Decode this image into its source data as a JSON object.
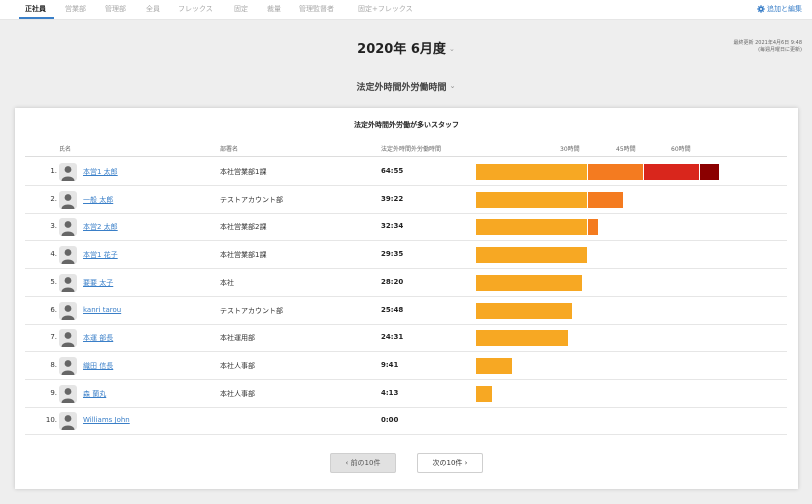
{
  "tabs": [
    {
      "label": "正社員",
      "active": true
    },
    {
      "label": "営業部",
      "active": false
    },
    {
      "label": "管理部",
      "active": false
    },
    {
      "label": "全員",
      "active": false
    },
    {
      "label": "フレックス",
      "active": false
    },
    {
      "label": "固定",
      "active": false
    },
    {
      "label": "裁量",
      "active": false
    },
    {
      "label": "管理監督者",
      "active": false
    },
    {
      "label": "固定+フレックス",
      "active": false
    }
  ],
  "add_edit_label": "追加と編集",
  "period": {
    "label": "2020年 6月度"
  },
  "last_updated": {
    "line1": "最終更新 2021年4月6日 9:48",
    "line2": "(毎週月曜日に更新)"
  },
  "metric_selector": {
    "label": "法定外時間外労働時間"
  },
  "card": {
    "title": "法定外時間外労働が多いスタッフ",
    "columns": {
      "name": "氏名",
      "dept": "部署名",
      "hours": "法定外時間外労働時間"
    },
    "ticks": [
      "30時間",
      "45時間",
      "60時間"
    ]
  },
  "colors": {
    "under_30": "#f7a823",
    "from_30_to_45": "#f47b20",
    "from_45_to_60": "#d9261c",
    "over_60": "#8b0000",
    "link": "#3a7fc8"
  },
  "rows": [
    {
      "rank": "1.",
      "name": "本営1 太郎",
      "dept": "本社営業部1課",
      "hours": "64:55",
      "hours_value": 64.92
    },
    {
      "rank": "2.",
      "name": "一般 太郎",
      "dept": "テストアカウント部",
      "hours": "39:22",
      "hours_value": 39.37
    },
    {
      "rank": "3.",
      "name": "本営2 太郎",
      "dept": "本社営業部2課",
      "hours": "32:34",
      "hours_value": 32.57
    },
    {
      "rank": "4.",
      "name": "本営1 花子",
      "dept": "本社営業部1課",
      "hours": "29:35",
      "hours_value": 29.58
    },
    {
      "rank": "5.",
      "name": "要要 太子",
      "dept": "本社",
      "hours": "28:20",
      "hours_value": 28.33
    },
    {
      "rank": "6.",
      "name": "kanri tarou",
      "dept": "テストアカウント部",
      "hours": "25:48",
      "hours_value": 25.8
    },
    {
      "rank": "7.",
      "name": "本運 部長",
      "dept": "本社運用部",
      "hours": "24:31",
      "hours_value": 24.52
    },
    {
      "rank": "8.",
      "name": "織田 信長",
      "dept": "本社人事部",
      "hours": "9:41",
      "hours_value": 9.68
    },
    {
      "rank": "9.",
      "name": "森 蘭丸",
      "dept": "本社人事部",
      "hours": "4:13",
      "hours_value": 4.22
    },
    {
      "rank": "10.",
      "name": "Williams John",
      "dept": "",
      "hours": "0:00",
      "hours_value": 0
    }
  ],
  "pagination": {
    "prev_label": "前の10件",
    "next_label": "次の10件"
  }
}
